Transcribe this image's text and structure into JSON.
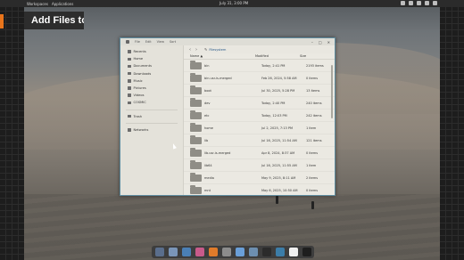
{
  "topbar": {
    "workspaces": "Workspaces",
    "applications": "Applications",
    "clock": "July 31, 3:00 PM"
  },
  "banner": {
    "title": "Add Files to"
  },
  "window": {
    "menus": [
      "File",
      "Edit",
      "View",
      "Sort"
    ],
    "controls": [
      "–",
      "□",
      "✕"
    ]
  },
  "sidebar": {
    "items": [
      {
        "label": "Recents",
        "icon": "clock-icon"
      },
      {
        "label": "Home",
        "icon": "home-icon"
      },
      {
        "label": "Documents",
        "icon": "document-icon"
      },
      {
        "label": "Downloads",
        "icon": "download-icon"
      },
      {
        "label": "Music",
        "icon": "music-icon"
      },
      {
        "label": "Pictures",
        "icon": "picture-icon"
      },
      {
        "label": "Videos",
        "icon": "video-icon"
      },
      {
        "label": "COSMIC",
        "icon": "folder-icon"
      },
      {
        "label": "Trash",
        "icon": "trash-icon"
      },
      {
        "label": "Networks",
        "icon": "network-icon"
      }
    ]
  },
  "pathbar": {
    "back": "‹",
    "forward": "›",
    "location": "Filesystem"
  },
  "columns": {
    "name": "Name ▲",
    "modified": "Modified",
    "size": "Size"
  },
  "files": [
    {
      "name": "bin",
      "modified": "Today, 2:41 PM",
      "size": "2193 items"
    },
    {
      "name": "bin.usr-is-merged",
      "modified": "Feb 26, 2024, 5:58 AM",
      "size": "0 items"
    },
    {
      "name": "boot",
      "modified": "Jul 30, 2025, 5:28 PM",
      "size": "13 items"
    },
    {
      "name": "dev",
      "modified": "Today, 2:40 PM",
      "size": "240 items"
    },
    {
      "name": "etc",
      "modified": "Today, 12:03 PM",
      "size": "242 items"
    },
    {
      "name": "home",
      "modified": "Jul 2, 2025, 7:13 PM",
      "size": "1 item"
    },
    {
      "name": "lib",
      "modified": "Jul 16, 2025, 11:54 AM",
      "size": "121 items"
    },
    {
      "name": "lib.usr-is-merged",
      "modified": "Apr 8, 2024, 8:37 AM",
      "size": "0 items"
    },
    {
      "name": "lib64",
      "modified": "Jul 16, 2025, 11:55 AM",
      "size": "1 item"
    },
    {
      "name": "media",
      "modified": "May 9, 2025, 8:11 AM",
      "size": "2 items"
    },
    {
      "name": "mnt",
      "modified": "May 6, 2025, 10:50 AM",
      "size": "0 items"
    }
  ],
  "dock": {
    "icons": [
      {
        "name": "launcher-icon",
        "color": "#5a6e8c"
      },
      {
        "name": "workspaces-icon",
        "color": "#7a95b8"
      },
      {
        "name": "files-icon",
        "color": "#4a7fb5"
      },
      {
        "name": "store-icon",
        "color": "#c85a8a"
      },
      {
        "name": "firefox-icon",
        "color": "#e07b2a"
      },
      {
        "name": "settings-icon",
        "color": "#8c8c8c"
      },
      {
        "name": "home-icon",
        "color": "#6a9fd8"
      },
      {
        "name": "text-editor-icon",
        "color": "#6d8fb0"
      },
      {
        "name": "terminal-icon",
        "color": "#2b2b2b"
      },
      {
        "name": "help-icon",
        "color": "#3c7da8"
      },
      {
        "name": "app-icon",
        "color": "#f0f0f0"
      },
      {
        "name": "monitor-icon",
        "color": "#1e1e1e"
      }
    ]
  }
}
